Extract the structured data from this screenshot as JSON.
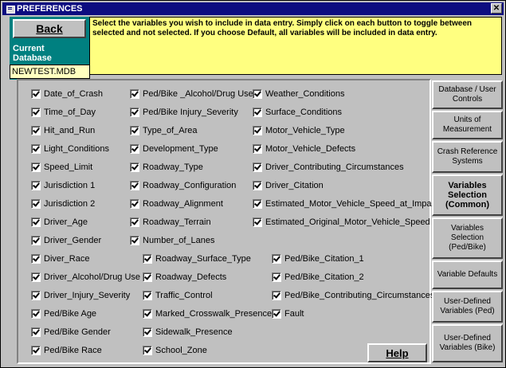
{
  "window": {
    "title": "PREFERENCES",
    "close_label": "✕"
  },
  "back_label": "Back",
  "current_db_label_1": "Current",
  "current_db_label_2": "Database",
  "db_name": "NEWTEST.MDB",
  "instructions": "Select the variables you wish to include in data entry. Simply click on each button to toggle between selected and not selected. If you choose Default, all variables will be included in data entry.",
  "col1": [
    "Date_of_Crash",
    "Time_of_Day",
    "Hit_and_Run",
    "Light_Conditions",
    "Speed_Limit",
    "Jurisdiction 1",
    "Jurisdiction 2",
    "Driver_Age",
    "Driver_Gender",
    "Diver_Race",
    "Driver_Alcohol/Drug Use",
    "Driver_Injury_Severity",
    "Ped/Bike Age",
    "Ped/Bike Gender",
    "Ped/Bike Race"
  ],
  "col2": [
    "Ped/Bike _Alcohol/Drug Use",
    "Ped/Bike Injury_Severity",
    "Type_of_Area",
    "Development_Type",
    "Roadway_Type",
    "Roadway_Configuration",
    "Roadway_Alignment",
    "Roadway_Terrain",
    "Number_of_Lanes"
  ],
  "col2b": [
    "Roadway_Surface_Type",
    "Roadway_Defects",
    "Traffic_Control",
    "Marked_Crosswalk_Presence",
    "Sidewalk_Presence",
    "School_Zone"
  ],
  "col3": [
    "Weather_Conditions",
    "Surface_Conditions",
    "Motor_Vehicle_Type",
    "Motor_Vehicle_Defects",
    "Driver_Contributing_Circumstances",
    "Driver_Citation",
    "Estimated_Motor_Vehicle_Speed_at_Impact",
    "Estimated_Original_Motor_Vehicle_Speed"
  ],
  "col3b": [
    "Ped/Bike_Citation_1",
    "Ped/Bike_Citation_2",
    "Ped/Bike_Contributing_Circumstances",
    "Fault"
  ],
  "help_label": "Help",
  "side_buttons": [
    {
      "label": "Database / User Controls"
    },
    {
      "label": "Units of Measurement"
    },
    {
      "label": "Crash Reference Systems"
    },
    {
      "label": "Variables Selection (Common)"
    },
    {
      "label": "Variables Selection (Ped/Bike)"
    },
    {
      "label": "Variable Defaults"
    },
    {
      "label": "User-Defined Variables (Ped)"
    },
    {
      "label": "User-Defined Variables (Bike)"
    }
  ]
}
